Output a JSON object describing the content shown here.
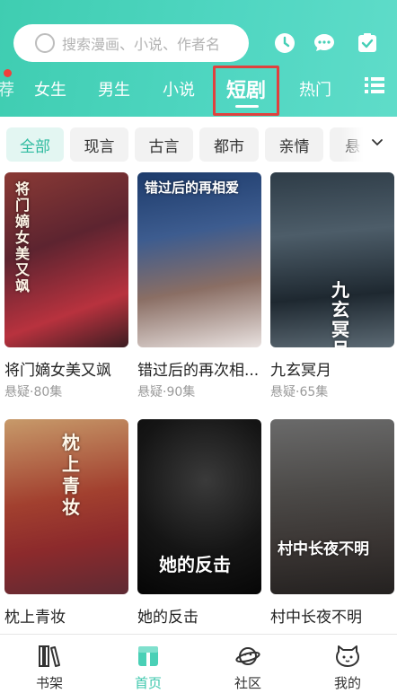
{
  "search": {
    "placeholder": "搜索漫画、小说、作者名"
  },
  "header_icons": [
    "clock-icon",
    "chat-icon",
    "task-check-icon"
  ],
  "tabs": [
    {
      "label": "女生"
    },
    {
      "label": "男生"
    },
    {
      "label": "小说"
    },
    {
      "label": "短剧"
    },
    {
      "label": "热门"
    }
  ],
  "active_tab": "短剧",
  "filters": [
    {
      "label": "全部"
    },
    {
      "label": "现言"
    },
    {
      "label": "古言"
    },
    {
      "label": "都市"
    },
    {
      "label": "亲情"
    },
    {
      "label": "悬"
    }
  ],
  "active_filter": "全部",
  "cards": [
    {
      "title": "将门嫡女美又飒",
      "meta": "悬疑·80集",
      "poster_text": "将门嫡女美又飒"
    },
    {
      "title": "错过后的再次相...",
      "meta": "悬疑·90集",
      "poster_text": "错过后的再相爱"
    },
    {
      "title": "九玄冥月",
      "meta": "悬疑·65集",
      "poster_text": "九玄冥月"
    },
    {
      "title": "枕上青妆",
      "meta": "",
      "poster_text": "枕上青妆"
    },
    {
      "title": "她的反击",
      "meta": "",
      "poster_text": "她的反击"
    },
    {
      "title": "村中长夜不明",
      "meta": "",
      "poster_text": "村中长夜不明"
    }
  ],
  "bottom_nav": [
    {
      "label": "书架",
      "icon": "bookshelf-icon"
    },
    {
      "label": "首页",
      "icon": "home-icon"
    },
    {
      "label": "社区",
      "icon": "community-planet-icon"
    },
    {
      "label": "我的",
      "icon": "profile-cat-icon"
    }
  ],
  "colors": {
    "accent": "#3cc7ac",
    "highlight_box": "#e0413e"
  }
}
